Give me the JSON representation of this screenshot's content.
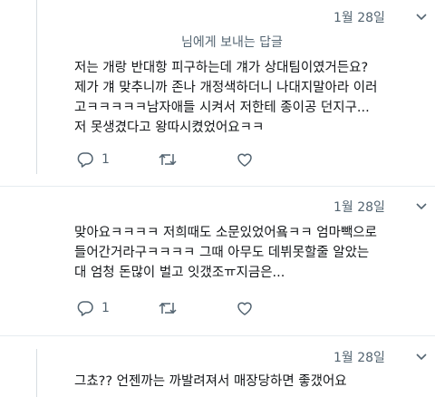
{
  "tweets": [
    {
      "date": "1월 28일",
      "reply_to": "님에게 보내는 답글",
      "text": "저는 개랑 반대항 피구하는데 걔가 상대팀이였거든요?\n제가 걔 맞추니까 존나 개정색하더니 나대지말아라 이러\n고ㅋㅋㅋㅋㅋ남자애들 시켜서 저한테 종이공 던지구...\n저 못생겼다고 왕따시켰었어요ㅋㅋ",
      "reply_count": "1",
      "retweet_count": "",
      "like_count": ""
    },
    {
      "date": "1월 28일",
      "text": "맞아요ㅋㅋㅋㅋ 저희때도 소문있었어욬ㅋㅋ 엄마빽으로\n들어간거라구ㅋㅋㅋㅋ 그때 아무도 데뷔못할줄 알았는\n대 엄청 돈많이 벌고 잇갰조ㅠ지금은...",
      "reply_count": "1",
      "retweet_count": "",
      "like_count": ""
    },
    {
      "date": "1월 28일",
      "text": "그쵸?? 언젠까는 까발려져서 매장당하면 좋갰어요"
    }
  ],
  "icons": {
    "reply": "reply-icon",
    "retweet": "retweet-icon",
    "like": "heart-icon",
    "more": "chevron-down-icon"
  },
  "colors": {
    "text": "#14171a",
    "muted": "#536471",
    "thread_line": "#d7dde2"
  }
}
